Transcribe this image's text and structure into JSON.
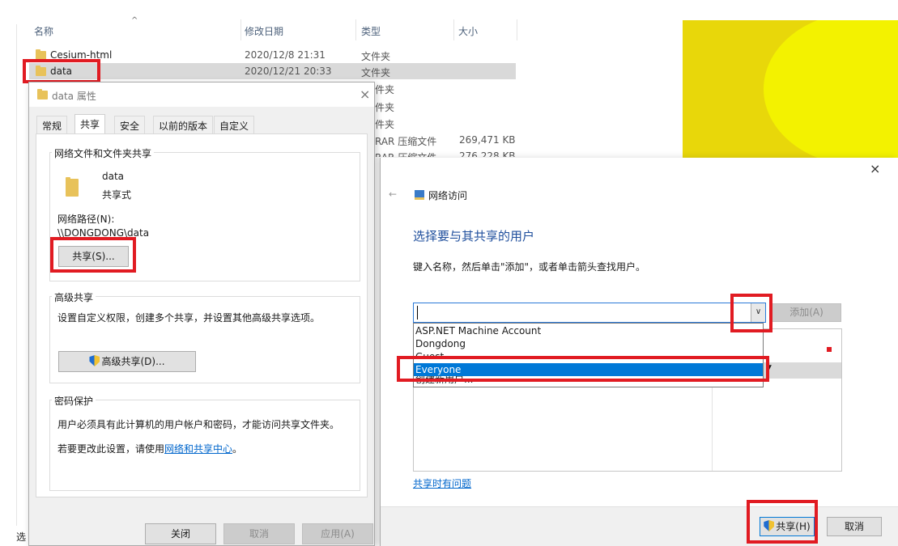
{
  "explorer": {
    "columns": {
      "name": "名称",
      "date": "修改日期",
      "type": "类型",
      "size": "大小"
    },
    "rows": [
      {
        "name": "Cesium-html",
        "date": "2020/12/8 21:31",
        "type": "文件夹",
        "size": ""
      },
      {
        "name": "data",
        "date": "2020/12/21 20:33",
        "type": "文件夹",
        "size": ""
      }
    ],
    "partial_rows": [
      {
        "type": "件夹",
        "size": ""
      },
      {
        "type": "件夹",
        "size": ""
      },
      {
        "type": "件夹",
        "size": ""
      },
      {
        "type": "RAR 压缩文件",
        "size": "269,471 KB"
      },
      {
        "type": "RAR 压缩文件",
        "size": "276,228 KB"
      }
    ],
    "status_left": "选"
  },
  "properties": {
    "title": "data 属性",
    "tabs": [
      "常规",
      "共享",
      "安全",
      "以前的版本",
      "自定义"
    ],
    "active_tab": "共享",
    "network_share": {
      "group_label": "网络文件和文件夹共享",
      "folder_name": "data",
      "share_state": "共享式",
      "path_label": "网络路径(N):",
      "path_value": "\\\\DONGDONG\\data",
      "share_button": "共享(S)..."
    },
    "advanced": {
      "group_label": "高级共享",
      "description": "设置自定义权限，创建多个共享，并设置其他高级共享选项。",
      "button": "高级共享(D)..."
    },
    "password": {
      "group_label": "密码保护",
      "description": "用户必须具有此计算机的用户帐户和密码，才能访问共享文件夹。",
      "change_prefix": "若要更改此设置，请使用",
      "change_link": "网络和共享中心",
      "change_suffix": "。"
    },
    "buttons": {
      "close": "关闭",
      "cancel": "取消",
      "apply": "应用(A)"
    }
  },
  "network_access": {
    "nav_title": "网络访问",
    "heading": "选择要与其共享的用户",
    "instruction": "键入名称，然后单击\"添加\"，或者单击箭头查找用户。",
    "input_value": "",
    "add_button": "添加(A)",
    "dropdown_options": [
      "ASP.NET Machine Account",
      "Dongdong",
      "Guest",
      "Everyone",
      "创建新用户..."
    ],
    "highlighted_option": "Everyone",
    "trouble_link": "共享时有问题",
    "share_button": "共享(H)",
    "cancel_button": "取消"
  },
  "colors": {
    "accent": "#0078d7",
    "link": "#0066cc",
    "annotation_red": "#e11b22",
    "heading_blue": "#1e4e9c",
    "wallpaper_yellow": "#e8d70a"
  }
}
